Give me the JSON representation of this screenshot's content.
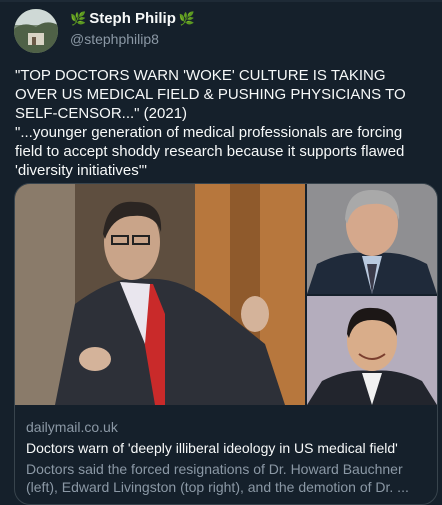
{
  "author": {
    "display_name": "Steph Philip",
    "leaf_left": "🌿",
    "leaf_right": "🌿",
    "handle": "@stephphilip8"
  },
  "tweet": {
    "text": "\"TOP DOCTORS WARN 'WOKE' CULTURE IS TAKING OVER US MEDICAL FIELD & PUSHING PHYSICIANS TO SELF-CENSOR...\" (2021)\n\"...younger generation of medical professionals are forcing field to accept shoddy research because it supports flawed 'diversity initiatives'\""
  },
  "link_card": {
    "domain": "dailymail.co.uk",
    "title": "Doctors warn of 'deeply illiberal ideology in US medical field'",
    "description": "Doctors said the forced resignations of Dr. Howard Bauchner (left), Edward Livingston (top right), and the demotion of Dr. ..."
  },
  "colors": {
    "background": "#15202b",
    "text_primary": "#f7f9f9",
    "text_secondary": "#8b98a5",
    "border": "#38444d"
  }
}
